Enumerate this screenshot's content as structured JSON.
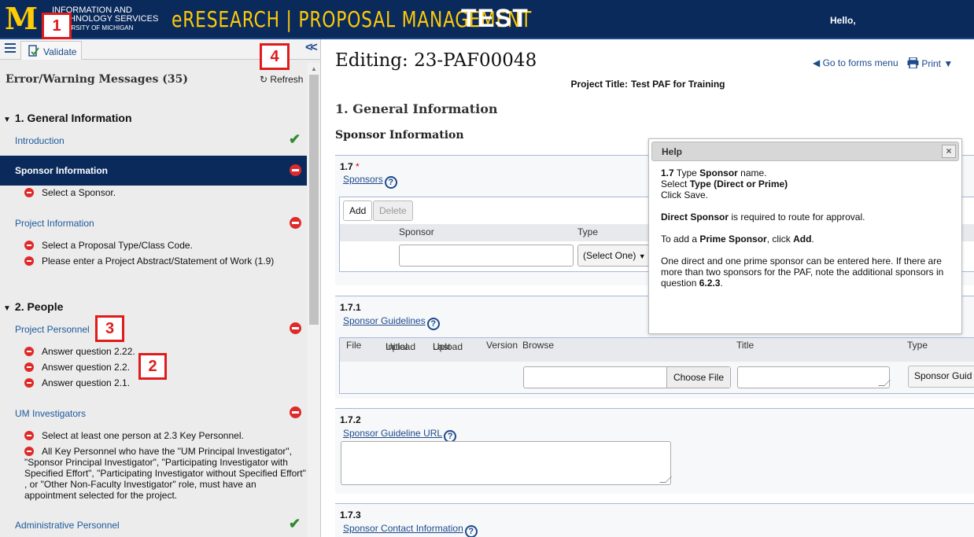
{
  "header": {
    "logo": "M",
    "its_line1": "INFORMATION AND",
    "its_line2": "TECHNOLOGY SERVICES",
    "its_line3": "UNIVERSITY OF MICHIGAN",
    "app_title": "eRESEARCH | PROPOSAL MANAGEMENT",
    "env": "TEST",
    "hello": "Hello,"
  },
  "callouts": [
    "1",
    "2",
    "3",
    "4"
  ],
  "left_panel": {
    "validate_label": "Validate",
    "messages_title": "Error/Warning Messages (35)",
    "refresh_label": "Refresh",
    "sections": [
      {
        "title": "1. General Information",
        "items": [
          {
            "label": "Introduction",
            "status": "ok"
          },
          {
            "label": "Sponsor Information",
            "status": "error",
            "errors": [
              "Select a Sponsor."
            ]
          },
          {
            "label": "Project Information",
            "status": "error",
            "errors": [
              "Select a Proposal Type/Class Code.",
              "Please enter a Project Abstract/Statement of Work (1.9)"
            ]
          }
        ]
      },
      {
        "title": "2. People",
        "items": [
          {
            "label": "Project Personnel",
            "status": "error",
            "errors": [
              "Answer question 2.22.",
              "Answer question 2.2.",
              "Answer question 2.1."
            ]
          },
          {
            "label": "UM Investigators",
            "status": "error",
            "errors": [
              "Select at least one person at 2.3 Key Personnel.",
              "All Key Personnel who have the \"UM Principal Investigator\", \"Sponsor Principal Investigator\", \"Participating Investigator with Specified Effort\", \"Participating Investigator without Specified Effort\" , or \"Other Non-Faculty Investigator\" role, must have an appointment selected for the project."
            ]
          },
          {
            "label": "Administrative Personnel",
            "status": "ok"
          }
        ]
      }
    ]
  },
  "main": {
    "editing_title": "Editing: 23-PAF00048",
    "goto_forms": "Go to forms menu",
    "print": "Print",
    "project_title_label": "Project Title:",
    "project_title": "Test PAF for Training",
    "section_title": "1. General Information",
    "subsection_title": "Sponsor Information",
    "q17": {
      "num": "1.7",
      "required_mark": "*",
      "link": "Sponsors",
      "add": "Add",
      "delete": "Delete",
      "col_sponsor": "Sponsor",
      "col_type": "Type",
      "select_value": "(Select One)"
    },
    "q171": {
      "num": "1.7.1",
      "link": "Sponsor Guidelines",
      "cols": {
        "file": "File",
        "initial_1": "Initial",
        "initial_2": "Upload",
        "last_1": "Last",
        "last_2": "Upload",
        "version": "Version",
        "browse": "Browse",
        "title": "Title",
        "type": "Type"
      },
      "choose_file": "Choose File",
      "type_button": "Sponsor Guid"
    },
    "q172": {
      "num": "1.7.2",
      "link": "Sponsor Guideline URL"
    },
    "q173": {
      "num": "1.7.3",
      "link": "Sponsor Contact Information"
    },
    "help_mark": "?"
  },
  "help": {
    "title": "Help",
    "close": "×",
    "p1_num": "1.7",
    "p1_a": " Type ",
    "p1_b": "Sponsor",
    "p1_c": " name.",
    "p1_d": "Select ",
    "p1_e": "Type (Direct or Prime)",
    "p1_f": "Click Save.",
    "p2_a": "Direct Sponsor",
    "p2_b": " is required to route for approval.",
    "p3_a": "To add a ",
    "p3_b": "Prime Sponsor",
    "p3_c": ", click ",
    "p3_d": "Add",
    "p3_e": ".",
    "p4_a": "One direct and one prime sponsor can be entered here. If there are more than two sponsors for the PAF, note the additional sponsors in question ",
    "p4_b": "6.2.3",
    "p4_c": "."
  },
  "colors": {
    "navy": "#0b2a5c",
    "maize": "#ffcb05",
    "error": "#e02a2a",
    "ok": "#2e8b2e",
    "callout": "#e01b1b"
  },
  "icons": [
    "hamburger-icon",
    "validate-icon",
    "collapse-icon",
    "refresh-icon",
    "error-icon",
    "check-icon",
    "help-icon",
    "print-icon",
    "close-icon",
    "chevron-left-icon"
  ]
}
